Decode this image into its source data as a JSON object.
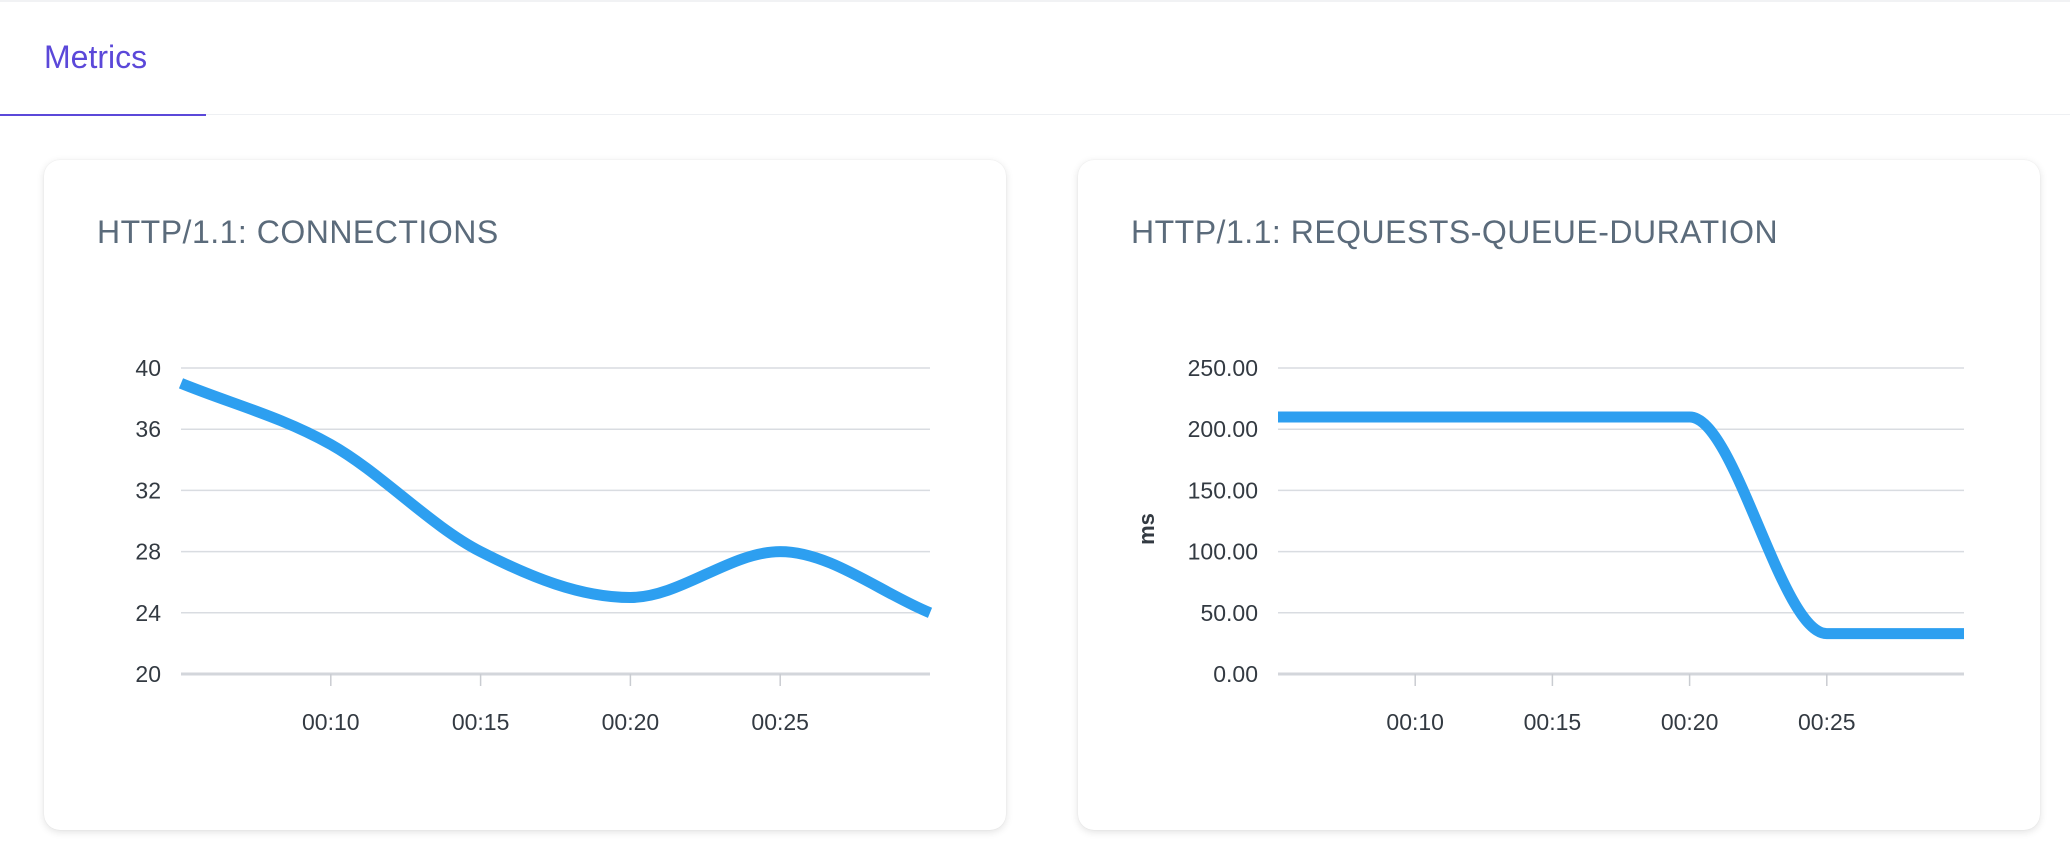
{
  "header": {
    "tab_label": "Metrics"
  },
  "colors": {
    "accent": "#5b48d9",
    "series": "#2d9ff0",
    "grid": "#d9dce1",
    "title": "#5b6b7b"
  },
  "chart_data": [
    {
      "type": "line",
      "title": "HTTP/1.1: CONNECTIONS",
      "xlabel": "",
      "ylabel": "",
      "xlim": [
        5,
        30
      ],
      "ylim": [
        20,
        40
      ],
      "y_ticks": [
        "40",
        "36",
        "32",
        "28",
        "24",
        "20"
      ],
      "y_tick_values": [
        40,
        36,
        32,
        28,
        24,
        20
      ],
      "x_ticks": [
        "00:10",
        "00:15",
        "00:20",
        "00:25"
      ],
      "x_tick_values": [
        10,
        15,
        20,
        25
      ],
      "x": [
        5,
        10,
        15,
        20,
        25,
        30
      ],
      "series": [
        {
          "values": [
            39,
            35,
            28,
            25,
            28,
            24
          ]
        }
      ],
      "grid": true,
      "smooth": true
    },
    {
      "type": "line",
      "title": "HTTP/1.1: REQUESTS-QUEUE-DURATION",
      "xlabel": "",
      "ylabel": "ms",
      "xlim": [
        5,
        30
      ],
      "ylim": [
        0,
        250
      ],
      "y_ticks": [
        "250.00",
        "200.00",
        "150.00",
        "100.00",
        "50.00",
        "0.00"
      ],
      "y_tick_values": [
        250,
        200,
        150,
        100,
        50,
        0
      ],
      "x_ticks": [
        "00:10",
        "00:15",
        "00:20",
        "00:25"
      ],
      "x_tick_values": [
        10,
        15,
        20,
        25
      ],
      "x": [
        5,
        10,
        15,
        20,
        25,
        30
      ],
      "series": [
        {
          "values": [
            210,
            210,
            210,
            210,
            33,
            33
          ]
        }
      ],
      "grid": true,
      "smooth": true
    }
  ]
}
